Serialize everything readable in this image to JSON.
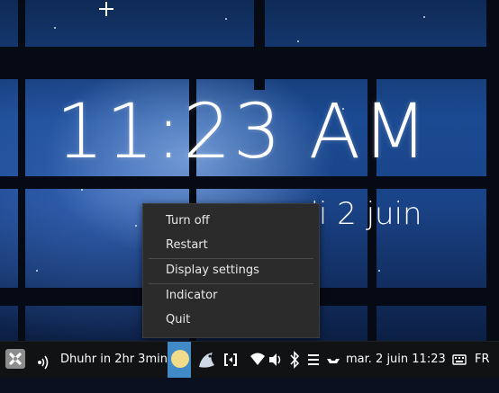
{
  "desktop": {
    "clock_time": "11:23 AM",
    "clock_date": "mardi  2 juin"
  },
  "context_menu": {
    "items": [
      {
        "label": "Turn off"
      },
      {
        "label": "Restart"
      },
      {
        "label": "Display settings"
      },
      {
        "label": "Indicator"
      },
      {
        "label": "Quit"
      }
    ]
  },
  "panel": {
    "prayer_indicator": "Dhuhr in 2hr 3min",
    "datetime": "mar.  2 juin 11:23",
    "keyboard_layout": "FR",
    "icons": [
      "distro-logo-icon",
      "signal-icon",
      "moon-icon",
      "pidgin-icon",
      "sync-icon",
      "wifi-icon",
      "volume-icon",
      "bluetooth-icon",
      "menu-icon",
      "mail-icon",
      "keyboard-icon"
    ],
    "accent_color": "#4aa0e8"
  }
}
